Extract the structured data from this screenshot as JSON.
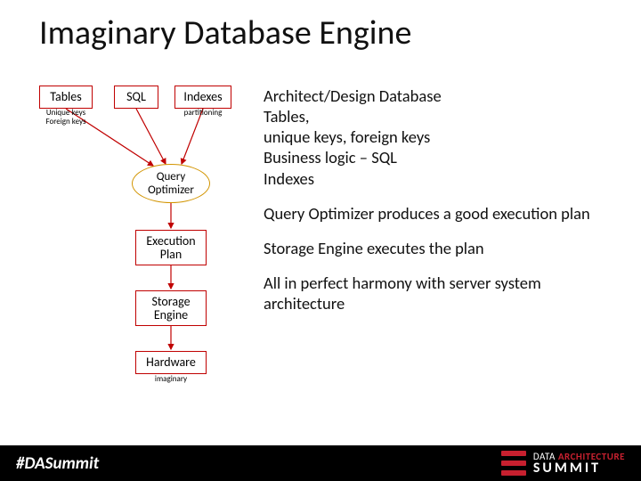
{
  "title": "Imaginary Database Engine",
  "diagram": {
    "tables": {
      "label": "Tables",
      "sub1": "Unique keys",
      "sub2": "Foreign keys"
    },
    "sql": {
      "label": "SQL"
    },
    "indexes": {
      "label": "Indexes",
      "sub": "partitioning"
    },
    "qo": {
      "l1": "Query",
      "l2": "Optimizer"
    },
    "exec": {
      "l1": "Execution",
      "l2": "Plan"
    },
    "storage": {
      "l1": "Storage",
      "l2": "Engine"
    },
    "hw": {
      "label": "Hardware",
      "sub": "imaginary"
    }
  },
  "bullets": {
    "p1l1": "Architect/Design Database",
    "p1l2": "Tables,",
    "p1l3": "unique keys, foreign keys",
    "p1l4": "Business logic – SQL",
    "p1l5": "Indexes",
    "p2": "Query Optimizer produces a good execution plan",
    "p3": "Storage Engine executes the plan",
    "p4": "All in perfect harmony with server system architecture"
  },
  "footer": {
    "hashtag": "#DASummit",
    "brand_l1a": "DATA ",
    "brand_l1b": "ARCHITECTURE",
    "brand_l2": "SUMMIT"
  },
  "colors": {
    "accent_red": "#c00000",
    "ellipse": "#d29400",
    "brand_red": "#c7202f"
  }
}
